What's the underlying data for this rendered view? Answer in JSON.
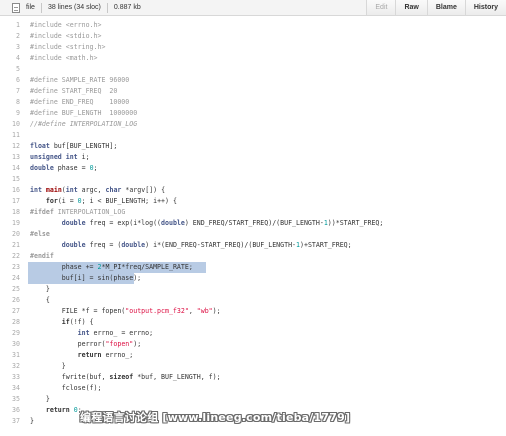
{
  "header": {
    "file_label": "file",
    "lines_info": "38 lines (34 sloc)",
    "size_info": "0.887 kb",
    "buttons": {
      "edit": "Edit",
      "raw": "Raw",
      "blame": "Blame",
      "history": "History"
    }
  },
  "code": {
    "highlighted_lines": [
      23,
      24
    ],
    "lines": [
      {
        "n": "1",
        "segs": [
          [
            "pp",
            "#include <errno.h>"
          ]
        ]
      },
      {
        "n": "2",
        "segs": [
          [
            "pp",
            "#include <stdio.h>"
          ]
        ]
      },
      {
        "n": "3",
        "segs": [
          [
            "pp",
            "#include <string.h>"
          ]
        ]
      },
      {
        "n": "4",
        "segs": [
          [
            "pp",
            "#include <math.h>"
          ]
        ]
      },
      {
        "n": "5",
        "segs": []
      },
      {
        "n": "6",
        "segs": [
          [
            "pp",
            "#define SAMPLE_RATE 96000"
          ]
        ]
      },
      {
        "n": "7",
        "segs": [
          [
            "pp",
            "#define START_FREQ  20"
          ]
        ]
      },
      {
        "n": "8",
        "segs": [
          [
            "pp",
            "#define END_FREQ    10000"
          ]
        ]
      },
      {
        "n": "9",
        "segs": [
          [
            "pp",
            "#define BUF_LENGTH  1000000"
          ]
        ]
      },
      {
        "n": "10",
        "segs": [
          [
            "cm",
            "//#define INTERPOLATION_LOG"
          ]
        ]
      },
      {
        "n": "11",
        "segs": []
      },
      {
        "n": "12",
        "segs": [
          [
            "kw-t",
            "float"
          ],
          [
            "",
            " buf[BUF_LENGTH];"
          ]
        ]
      },
      {
        "n": "13",
        "segs": [
          [
            "kw-t",
            "unsigned int"
          ],
          [
            "",
            " i;"
          ]
        ]
      },
      {
        "n": "14",
        "segs": [
          [
            "kw-t",
            "double"
          ],
          [
            "",
            " phase = "
          ],
          [
            "num",
            "0"
          ],
          [
            "",
            ";"
          ]
        ]
      },
      {
        "n": "15",
        "segs": []
      },
      {
        "n": "16",
        "segs": [
          [
            "kw-t",
            "int"
          ],
          [
            "",
            " "
          ],
          [
            "fn",
            "main"
          ],
          [
            "",
            "("
          ],
          [
            "kw-t",
            "int"
          ],
          [
            "",
            " argc, "
          ],
          [
            "kw-t",
            "char"
          ],
          [
            "",
            " *argv[]) {"
          ]
        ]
      },
      {
        "n": "17",
        "segs": [
          [
            "",
            "    "
          ],
          [
            "kw",
            "for"
          ],
          [
            "",
            "(i = "
          ],
          [
            "num",
            "0"
          ],
          [
            "",
            "; i < BUF_LENGTH; i++) {"
          ]
        ]
      },
      {
        "n": "18",
        "segs": [
          [
            "pp-b",
            "#ifdef"
          ],
          [
            "pp",
            " INTERPOLATION_LOG"
          ]
        ]
      },
      {
        "n": "19",
        "segs": [
          [
            "",
            "        "
          ],
          [
            "kw-t",
            "double"
          ],
          [
            "",
            " freq = exp(i*log(("
          ],
          [
            "kw-t",
            "double"
          ],
          [
            "",
            ") END_FREQ/START_FREQ)/(BUF_LENGTH-"
          ],
          [
            "num",
            "1"
          ],
          [
            "",
            "))*START_FREQ;"
          ]
        ]
      },
      {
        "n": "20",
        "segs": [
          [
            "pp-b",
            "#else"
          ]
        ]
      },
      {
        "n": "21",
        "segs": [
          [
            "",
            "        "
          ],
          [
            "kw-t",
            "double"
          ],
          [
            "",
            " freq = ("
          ],
          [
            "kw-t",
            "double"
          ],
          [
            "",
            ") i*(END_FREQ-START_FREQ)/(BUF_LENGTH-"
          ],
          [
            "num",
            "1"
          ],
          [
            "",
            ")+START_FREQ;"
          ]
        ]
      },
      {
        "n": "22",
        "segs": [
          [
            "pp-b",
            "#endif"
          ]
        ]
      },
      {
        "n": "23",
        "segs": [
          [
            "",
            "        phase += "
          ],
          [
            "num",
            "2"
          ],
          [
            "",
            "*M_PI*freq/SAMPLE_RATE;"
          ]
        ]
      },
      {
        "n": "24",
        "segs": [
          [
            "",
            "        buf[i] = sin(phase);"
          ]
        ]
      },
      {
        "n": "25",
        "segs": [
          [
            "",
            "    }"
          ]
        ]
      },
      {
        "n": "26",
        "segs": [
          [
            "",
            "    {"
          ]
        ]
      },
      {
        "n": "27",
        "segs": [
          [
            "",
            "        FILE *f = fopen("
          ],
          [
            "str",
            "\"output.pcm_f32\""
          ],
          [
            "",
            ", "
          ],
          [
            "str",
            "\"wb\""
          ],
          [
            "",
            ");"
          ]
        ]
      },
      {
        "n": "28",
        "segs": [
          [
            "",
            "        "
          ],
          [
            "kw",
            "if"
          ],
          [
            "",
            "(!f) {"
          ]
        ]
      },
      {
        "n": "29",
        "segs": [
          [
            "",
            "            "
          ],
          [
            "kw-t",
            "int"
          ],
          [
            "",
            " errno_ = errno;"
          ]
        ]
      },
      {
        "n": "30",
        "segs": [
          [
            "",
            "            perror("
          ],
          [
            "str",
            "\"fopen\""
          ],
          [
            "",
            ");"
          ]
        ]
      },
      {
        "n": "31",
        "segs": [
          [
            "",
            "            "
          ],
          [
            "kw",
            "return"
          ],
          [
            "",
            " errno_;"
          ]
        ]
      },
      {
        "n": "32",
        "segs": [
          [
            "",
            "        }"
          ]
        ]
      },
      {
        "n": "33",
        "segs": [
          [
            "",
            "        fwrite(buf, "
          ],
          [
            "kw",
            "sizeof"
          ],
          [
            "",
            " *buf, BUF_LENGTH, f);"
          ]
        ]
      },
      {
        "n": "34",
        "segs": [
          [
            "",
            "        fclose(f);"
          ]
        ]
      },
      {
        "n": "35",
        "segs": [
          [
            "",
            "    }"
          ]
        ]
      },
      {
        "n": "36",
        "segs": [
          [
            "",
            "    "
          ],
          [
            "kw",
            "return"
          ],
          [
            "",
            " "
          ],
          [
            "num",
            "0"
          ],
          [
            "",
            ";"
          ]
        ]
      },
      {
        "n": "37",
        "segs": [
          [
            "",
            "}"
          ]
        ]
      }
    ]
  },
  "watermark": {
    "text": "编程语言讨论组 [www.lineeg.com/tieba/1779]"
  }
}
